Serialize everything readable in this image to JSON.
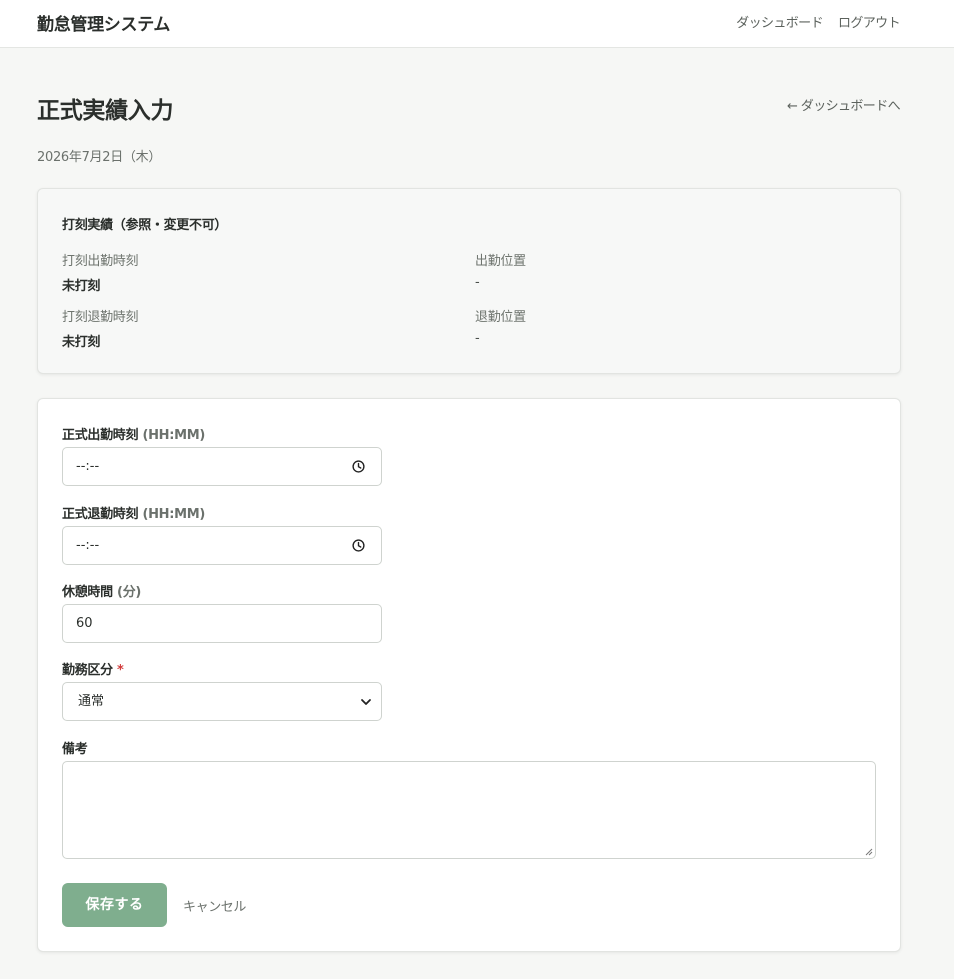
{
  "header": {
    "app_title": "勤怠管理システム",
    "nav": [
      {
        "label": "ダッシュボード"
      },
      {
        "label": "ログアウト"
      }
    ]
  },
  "page": {
    "title": "正式実績入力",
    "back_link": "← ダッシュボードへ",
    "date": "2026年7月2日（木）"
  },
  "punch_record": {
    "title": "打刻実績（参照・変更不可）",
    "clock_in_label": "打刻出勤時刻",
    "clock_in_value": "未打刻",
    "clock_in_location_label": "出勤位置",
    "clock_in_location_value": "-",
    "clock_out_label": "打刻退勤時刻",
    "clock_out_value": "未打刻",
    "clock_out_location_label": "退勤位置",
    "clock_out_location_value": "-"
  },
  "form": {
    "start_time": {
      "label": "正式出勤時刻",
      "hint": "(HH:MM)",
      "value": "--:--"
    },
    "end_time": {
      "label": "正式退勤時刻",
      "hint": "(HH:MM)",
      "value": "--:--"
    },
    "break_time": {
      "label": "休憩時間",
      "hint": "(分)",
      "value": "60"
    },
    "work_type": {
      "label": "勤務区分",
      "required_mark": "*",
      "selected": "通常"
    },
    "notes": {
      "label": "備考",
      "value": ""
    },
    "save_label": "保存する",
    "cancel_label": "キャンセル"
  },
  "colors": {
    "accent": "#7fae8e",
    "required": "#d23b3b",
    "background": "#f6f7f5"
  },
  "icons": {
    "time_input": "clock-icon",
    "select": "chevron-down-icon",
    "textarea": "resize-grip-icon"
  }
}
